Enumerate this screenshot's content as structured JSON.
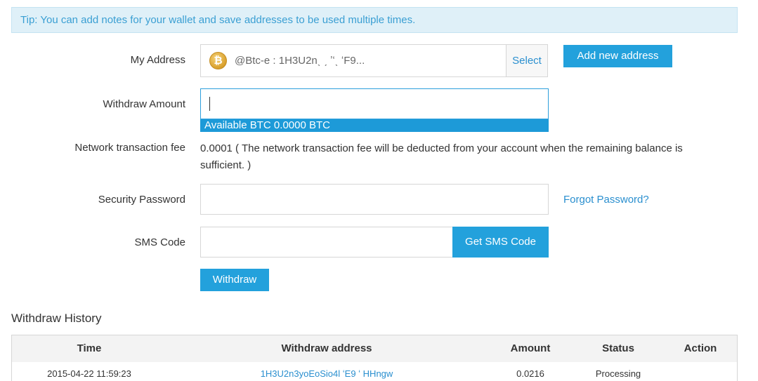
{
  "tip": "Tip: You can add notes for your wallet and save addresses to be used multiple times.",
  "form": {
    "my_address_label": "My Address",
    "address_value": "@Btc-e : 1H3U2nˎ  ˏ          ʼʻˎ          ʻF9...",
    "select_label": "Select",
    "add_address_label": "Add new address",
    "withdraw_amount_label": "Withdraw Amount",
    "available_text": "Available BTC 0.0000 BTC",
    "fee_label": "Network transaction fee",
    "fee_text": "0.0001 ( The network transaction fee will be deducted from your account when the remaining balance is sufficient. )",
    "security_password_label": "Security Password",
    "forgot_password_label": "Forgot Password?",
    "sms_code_label": "SMS Code",
    "get_sms_label": "Get SMS Code",
    "withdraw_button_label": "Withdraw"
  },
  "history": {
    "title": "Withdraw History",
    "columns": [
      "Time",
      "Withdraw address",
      "Amount",
      "Status",
      "Action"
    ],
    "rows": [
      {
        "time": "2015-04-22 11:59:23",
        "address": "1H3U2n3yoEoSio4l     ʻE9   ʻ     HHngw",
        "amount": "0.0216",
        "status": "Processing",
        "action": ""
      }
    ]
  },
  "icons": {
    "coin": "bitcoin-icon"
  },
  "colors": {
    "accent": "#23a1dc",
    "link": "#2a8fcf",
    "tip_bg": "#dff0f8"
  }
}
